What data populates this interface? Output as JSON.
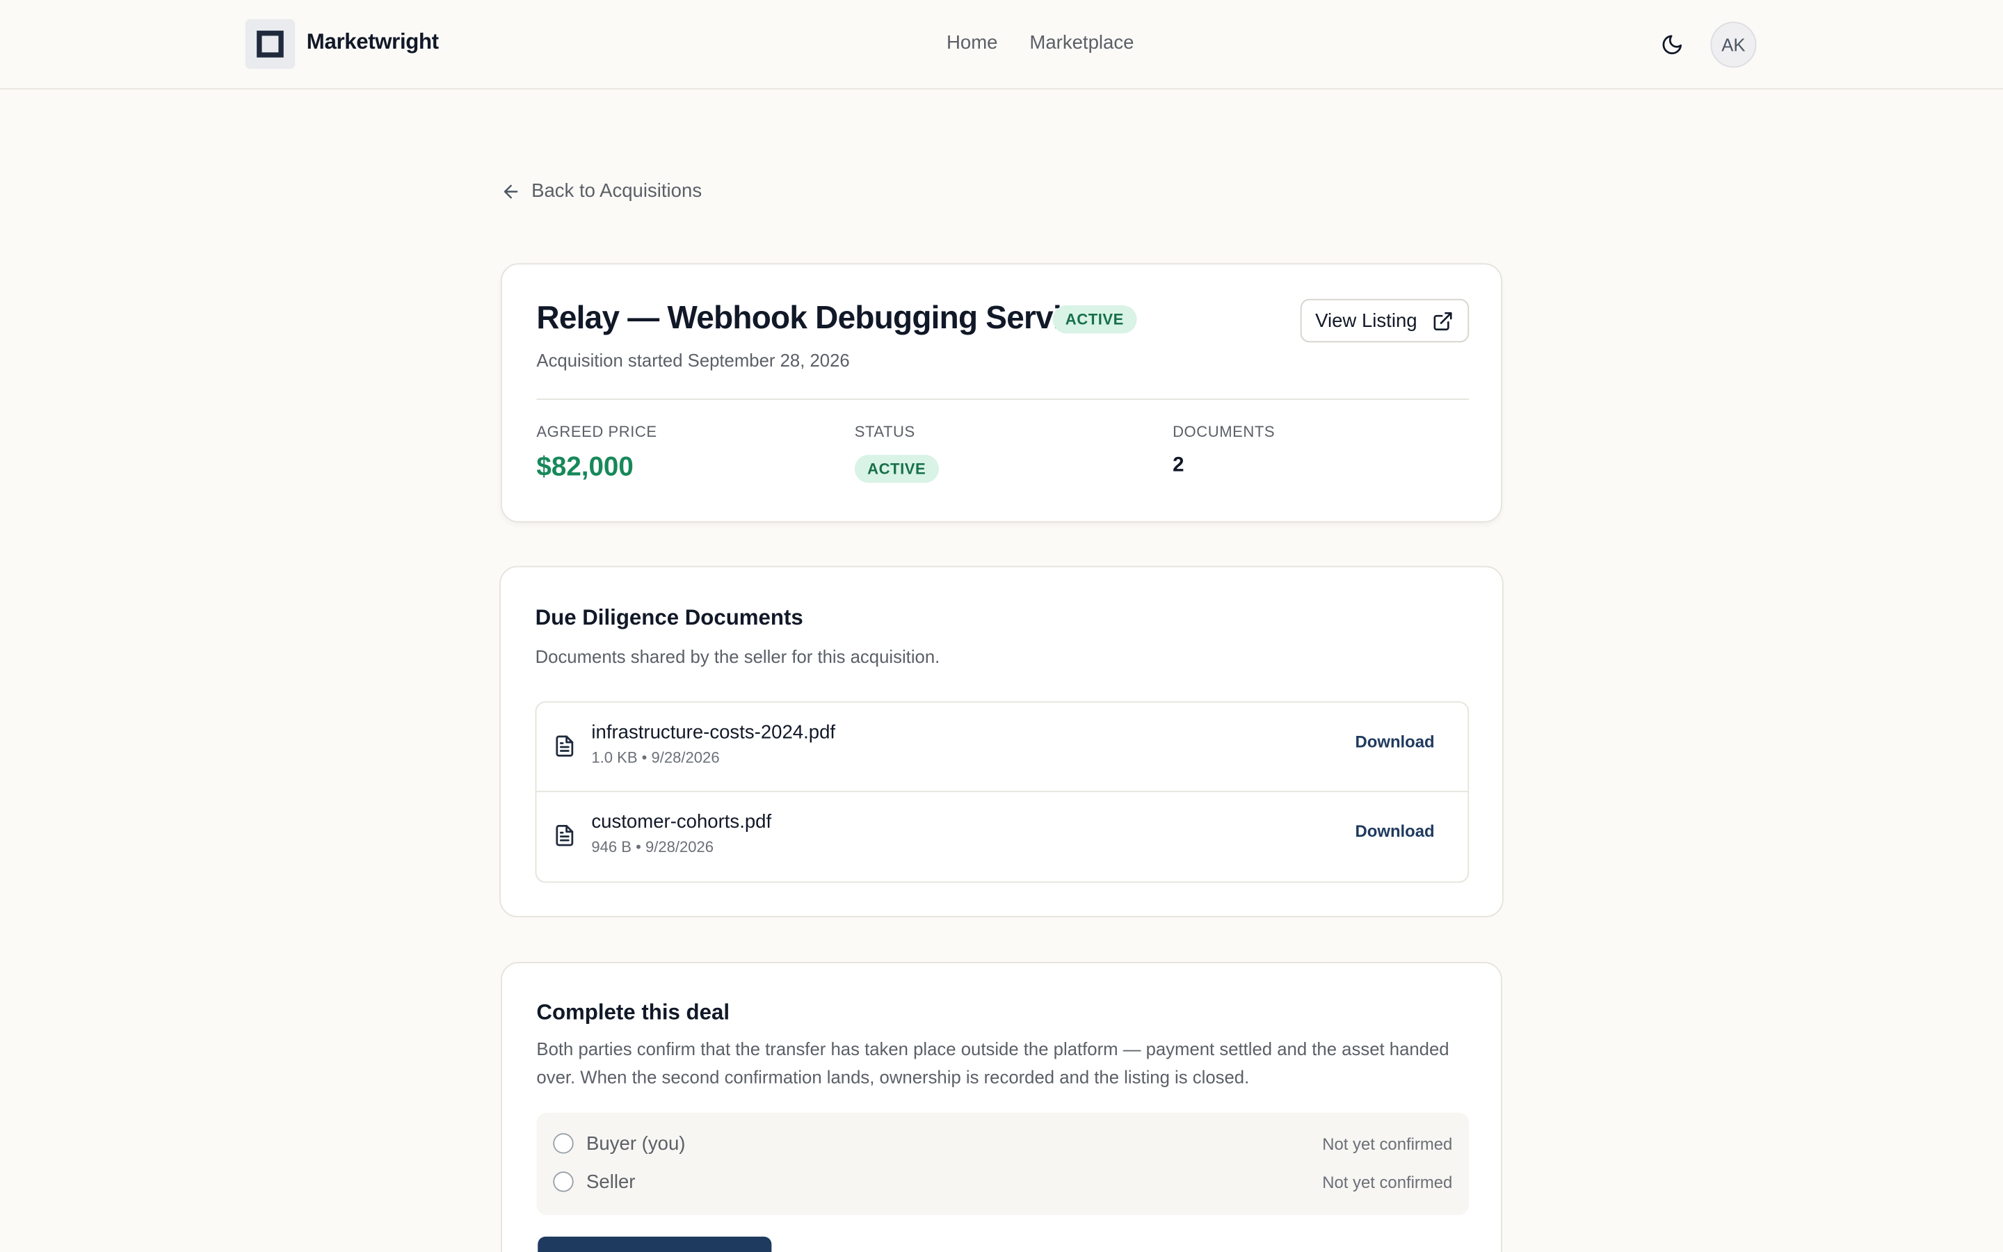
{
  "header": {
    "brand": "Marketwright",
    "nav": [
      {
        "label": "Home"
      },
      {
        "label": "Marketplace"
      }
    ],
    "avatar_initials": "AK",
    "theme_icon": "moon-icon"
  },
  "back_link": {
    "label": "Back to Acquisitions",
    "icon": "arrow-left-icon"
  },
  "summary": {
    "title": "Relay — Webhook Debugging Service",
    "status_badge": "ACTIVE",
    "subtitle": "Acquisition started September 28, 2026",
    "view_listing_label": "View Listing",
    "view_listing_icon": "external-link-icon",
    "stats": {
      "price_label": "AGREED PRICE",
      "price_value": "$82,000",
      "status_label": "STATUS",
      "status_value": "ACTIVE",
      "documents_label": "DOCUMENTS",
      "documents_value": "2"
    }
  },
  "documents": {
    "title": "Due Diligence Documents",
    "description": "Documents shared by the seller for this acquisition.",
    "files": [
      {
        "name": "infrastructure-costs-2024.pdf",
        "meta": "1.0 KB • 9/28/2026",
        "action": "Download",
        "icon": "file-text-icon"
      },
      {
        "name": "customer-cohorts.pdf",
        "meta": "946 B • 9/28/2026",
        "action": "Download",
        "icon": "file-text-icon"
      }
    ]
  },
  "complete": {
    "title": "Complete this deal",
    "description": "Both parties confirm that the transfer has taken place outside the platform — payment settled and the asset handed over. When the second confirmation lands, ownership is recorded and the listing is closed.",
    "parties": [
      {
        "label": "Buyer (you)",
        "status": "Not yet confirmed"
      },
      {
        "label": "Seller",
        "status": "Not yet confirmed"
      }
    ]
  },
  "colors": {
    "accent_navy": "#1f3a5f",
    "price_green": "#17885a",
    "badge_bg": "#d9f3e6",
    "badge_text": "#17704a",
    "page_bg": "#fbfaf7"
  }
}
